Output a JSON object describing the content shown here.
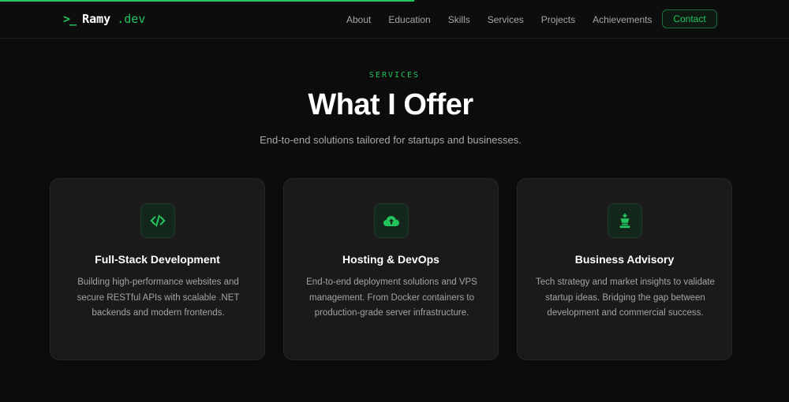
{
  "header": {
    "logo_icon": ">_",
    "logo_name": "Ramy",
    "logo_ext": ".dev",
    "nav": [
      "About",
      "Education",
      "Skills",
      "Services",
      "Projects",
      "Achievements"
    ],
    "contact_label": "Contact"
  },
  "scroll_progress_fraction": 0.525,
  "section": {
    "label": "SERVICES",
    "title": "What I Offer",
    "subtitle": "End-to-end solutions tailored for startups and businesses."
  },
  "cards": [
    {
      "icon": "code-icon",
      "title": "Full-Stack Development",
      "description": "Building high-performance websites and secure RESTful APIs with scalable .NET backends and modern frontends."
    },
    {
      "icon": "cloud-upload-icon",
      "title": "Hosting & DevOps",
      "description": "End-to-end deployment solutions and VPS management. From Docker containers to production-grade server infrastructure."
    },
    {
      "icon": "chess-king-icon",
      "title": "Business Advisory",
      "description": "Tech strategy and market insights to validate startup ideas. Bridging the gap between development and commercial success."
    }
  ],
  "colors": {
    "accent": "#22c55e",
    "background": "#0c0c0c",
    "card": "#1a1a1a"
  }
}
